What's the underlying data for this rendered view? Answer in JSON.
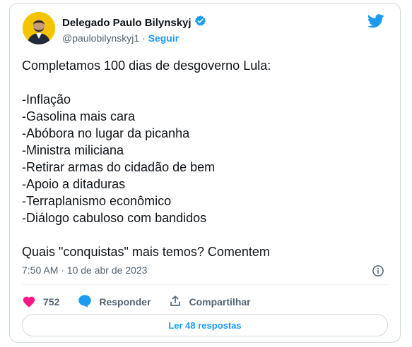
{
  "author": {
    "name": "Delegado Paulo Bilynskyj",
    "handle": "@paulobilynskyj1",
    "separator": " · ",
    "follow_label": "Seguir"
  },
  "tweet": {
    "text": "Completamos 100 dias de desgoverno Lula:\n\n-Inflação\n-Gasolina mais cara\n-Abóbora no lugar da picanha\n-Ministra miliciana\n-Retirar armas do cidadão de bem\n-Apoio a ditaduras\n-Terraplanismo econômico\n-Diálogo cabuloso com bandidos\n\nQuais \"conquistas\" mais temos? Comentem",
    "timestamp": "7:50 AM · 10 de abr de 2023"
  },
  "actions": {
    "likes": "752",
    "reply_label": "Responder",
    "share_label": "Compartilhar"
  },
  "footer": {
    "read_replies_label": "Ler 48 respostas"
  },
  "colors": {
    "accent": "#1d9bf0",
    "like": "#f91880",
    "muted": "#536471"
  },
  "icons": [
    "verified-badge-icon",
    "twitter-bird-icon",
    "info-icon",
    "heart-icon",
    "reply-bubble-icon",
    "share-icon"
  ]
}
